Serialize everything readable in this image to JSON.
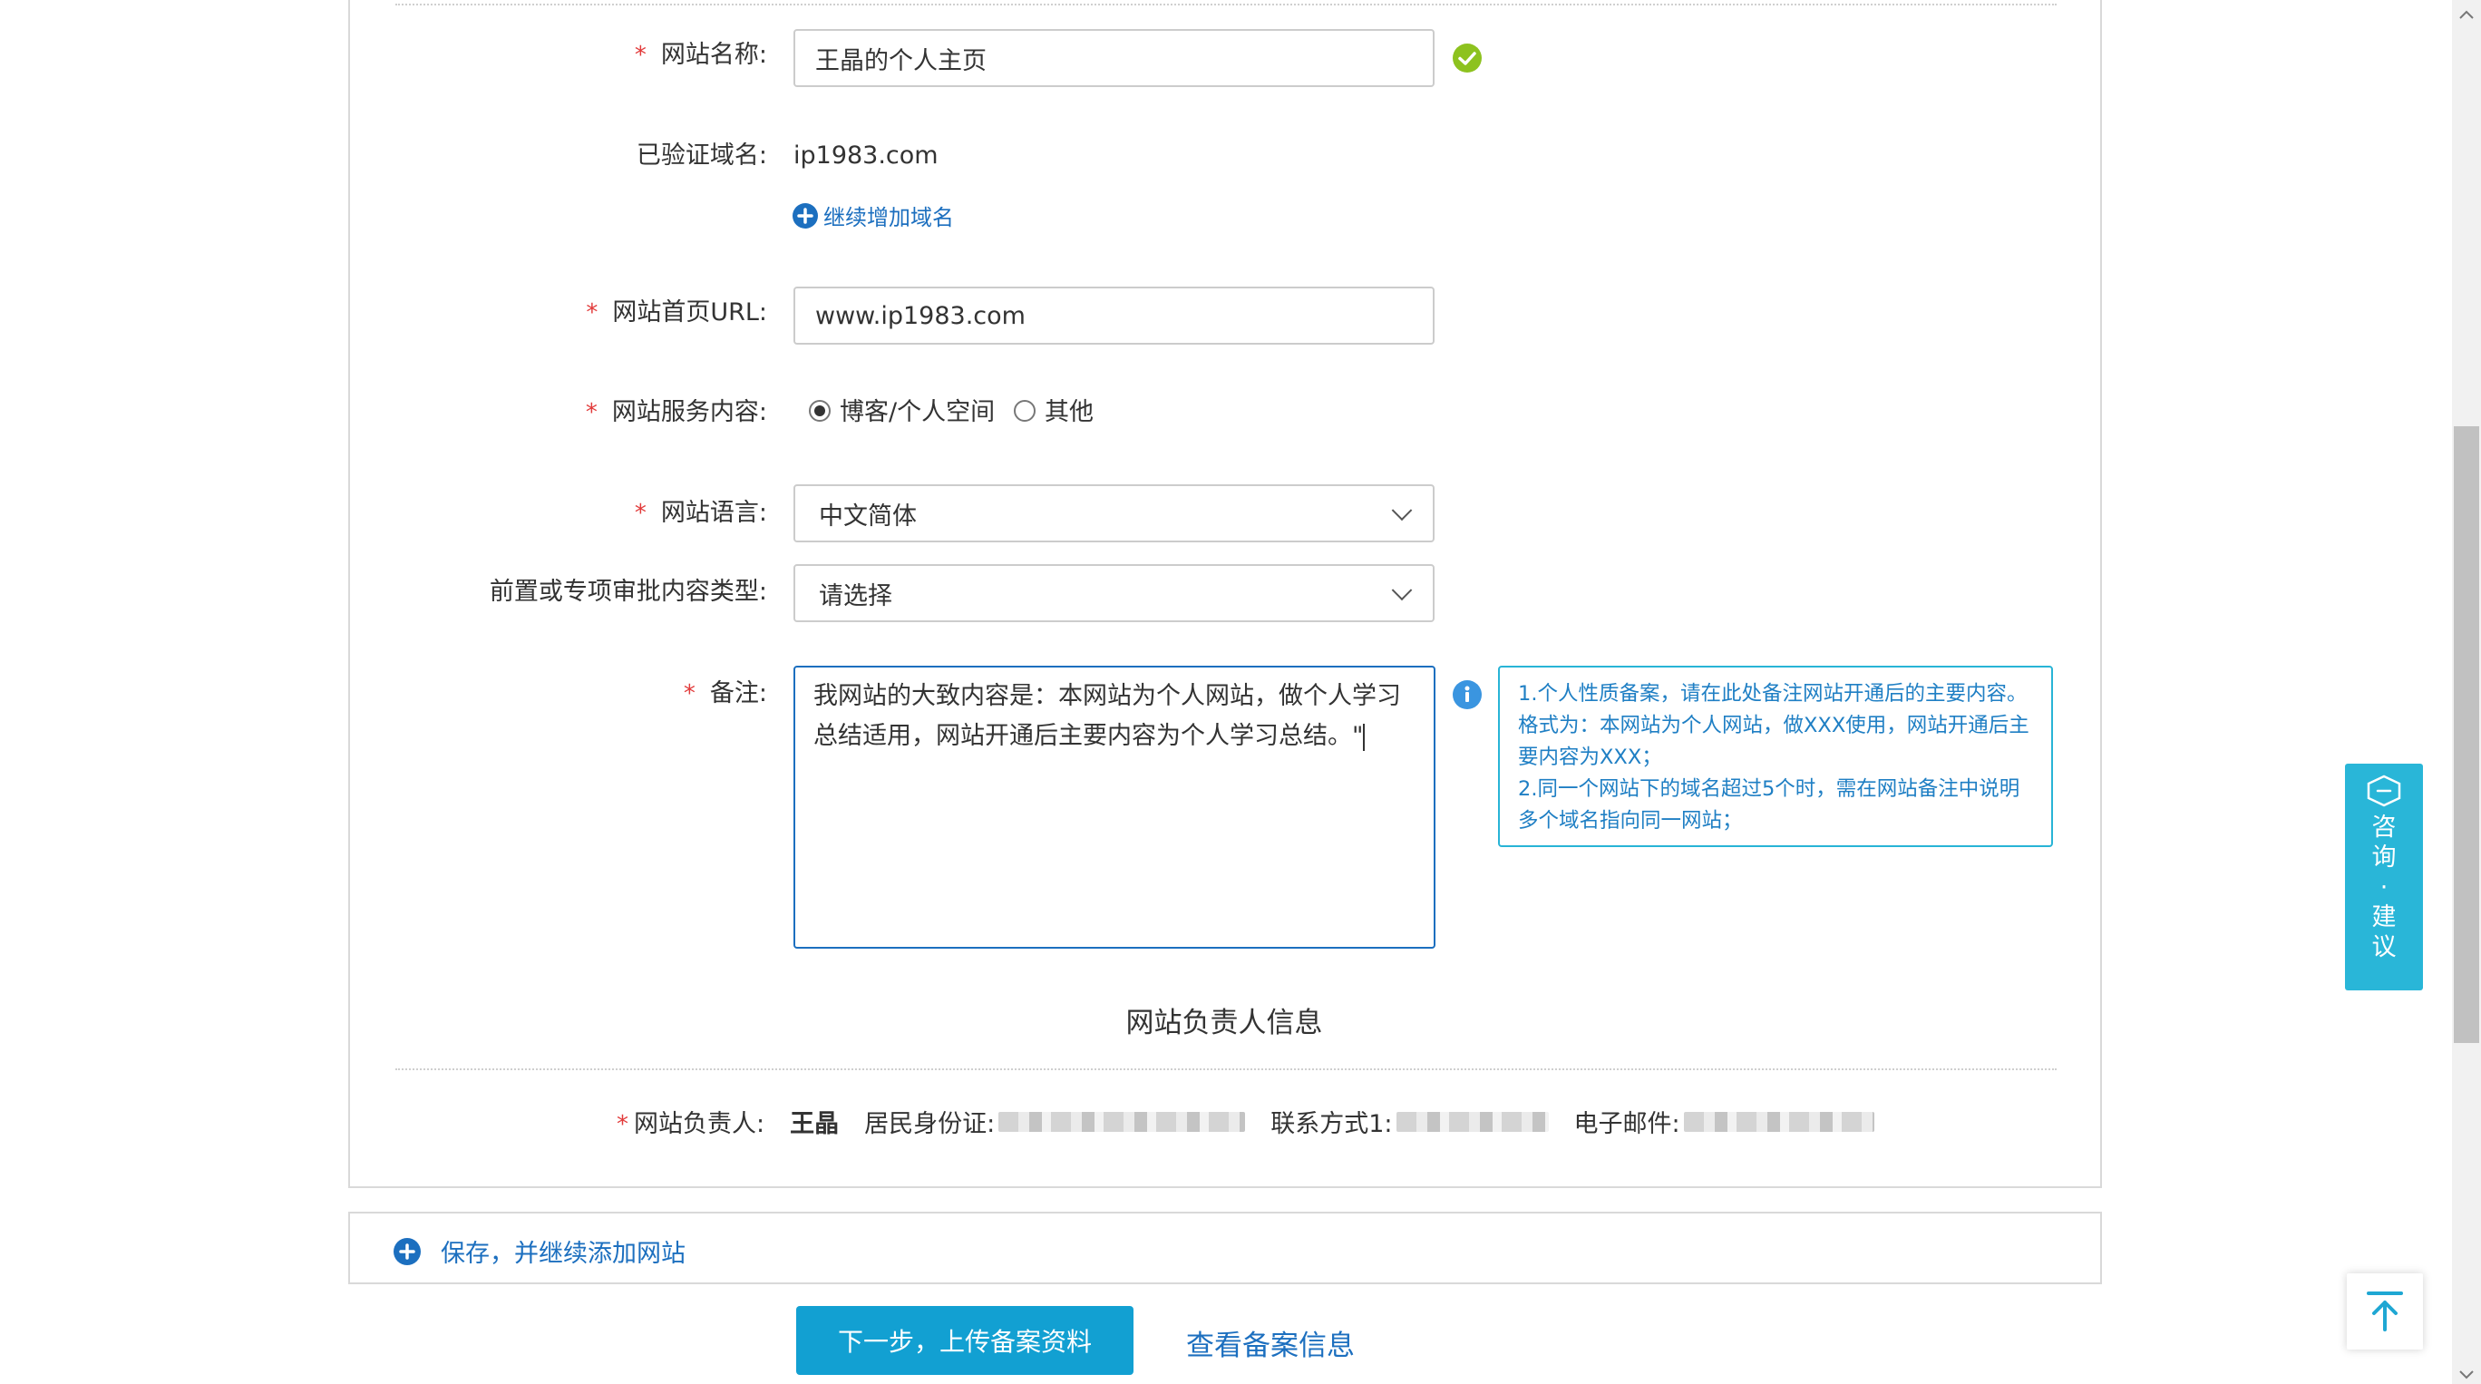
{
  "form": {
    "site_name": {
      "label": "网站名称:",
      "value": "王晶的个人主页"
    },
    "verified_domain": {
      "label": "已验证域名:",
      "value": "ip1983.com",
      "add_link": "继续增加域名"
    },
    "home_url": {
      "label": "网站首页URL:",
      "value": "www.ip1983.com"
    },
    "service_content": {
      "label": "网站服务内容:",
      "options": [
        "博客/个人空间",
        "其他"
      ],
      "selected": "博客/个人空间"
    },
    "language": {
      "label": "网站语言:",
      "value": "中文简体"
    },
    "approval_type": {
      "label": "前置或专项审批内容类型:",
      "value": "请选择"
    },
    "remarks": {
      "label": "备注:",
      "value": "我网站的大致内容是：本网站为个人网站，做个人学习总结适用，网站开通后主要内容为个人学习总结。\""
    },
    "tip": {
      "line1": "1.个人性质备案，请在此处备注网站开通后的主要内容。格式为：本网站为个人网站，做XXX使用，网站开通后主要内容为XXX；",
      "line2": "2.同一个网站下的域名超过5个时，需在网站备注中说明多个域名指向同一网站；"
    }
  },
  "owner_section": {
    "title": "网站负责人信息",
    "label": "网站负责人:",
    "name": "王晶",
    "id_label": "居民身份证:",
    "phone_label": "联系方式1:",
    "email_label": "电子邮件:"
  },
  "actions": {
    "save_continue": "保存，并继续添加网站",
    "next": "下一步，上传备案资料",
    "view_info": "查看备案信息"
  },
  "float": {
    "consult_chars": [
      "咨",
      "询",
      "·",
      "建",
      "议"
    ]
  },
  "colors": {
    "primary": "#12a0d2",
    "link": "#1c6fbf",
    "required": "#e23b3b",
    "success": "#8dc21f",
    "tip_border": "#28b4d6"
  }
}
